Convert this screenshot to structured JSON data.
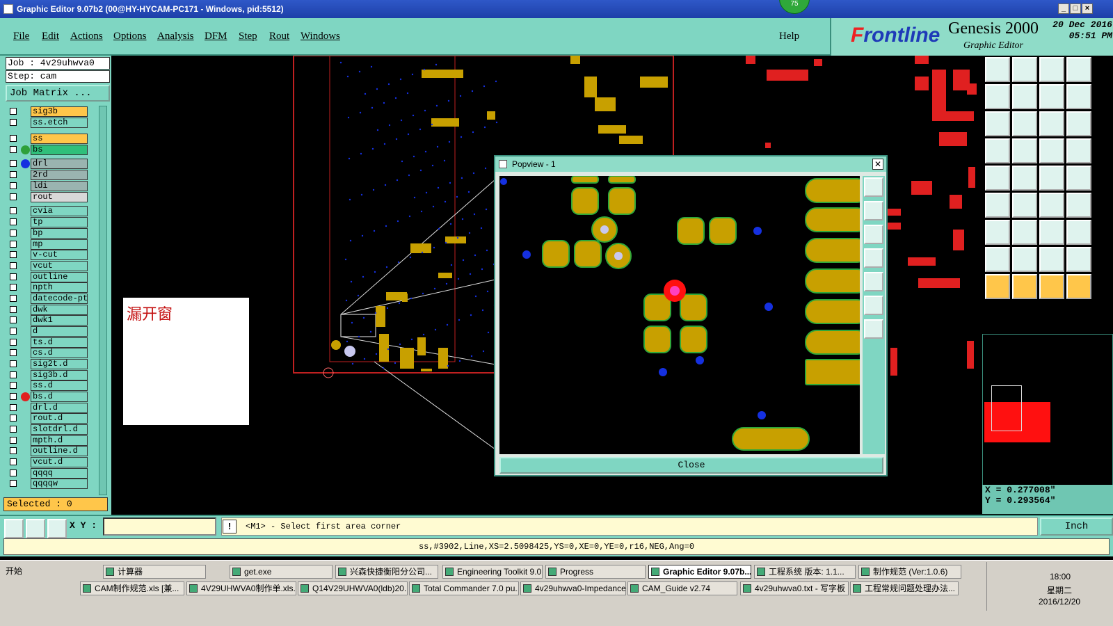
{
  "window": {
    "title": "Graphic Editor 9.07b2 (00@HY-HYCAM-PC171 - Windows, pid:5512)",
    "badge": "75"
  },
  "menu": {
    "items": [
      "File",
      "Edit",
      "Actions",
      "Options",
      "Analysis",
      "DFM",
      "Step",
      "Rout",
      "Windows"
    ],
    "help": "Help"
  },
  "brand": {
    "logo_f": "F",
    "logo_rest": "rontline",
    "product": "Genesis 2000",
    "subtitle": "Graphic Editor",
    "date": "20 Dec 2016",
    "time": "05:51 PM"
  },
  "job": {
    "job_label": "Job  : 4v29uhwva0",
    "step_label": "Step: cam",
    "matrix_button": "Job Matrix ..."
  },
  "layers": [
    {
      "name": "sig3b",
      "color": "#ffc64a",
      "dot": "",
      "mark": "✎"
    },
    {
      "name": "ss.etch",
      "color": "#7fd6c2",
      "dot": "",
      "mark": ""
    },
    {
      "name": "ss",
      "color": "#ffc64a",
      "dot": "",
      "mark": "✎"
    },
    {
      "name": "bs",
      "color": "#2fbf7a",
      "dot": "#2fa03a",
      "mark": ""
    },
    {
      "name": "drl",
      "color": "#9ab4b0",
      "dot": "#1530e0",
      "mark": ""
    },
    {
      "name": "2rd",
      "color": "#9ab4b0",
      "dot": "",
      "mark": ""
    },
    {
      "name": "ldi",
      "color": "#9ab4b0",
      "dot": "",
      "mark": ""
    },
    {
      "name": "rout",
      "color": "#d8d8d8",
      "dot": "",
      "mark": ""
    },
    {
      "name": "cvia",
      "color": "#7fd6c2",
      "dot": "",
      "mark": ""
    },
    {
      "name": "tp",
      "color": "#7fd6c2",
      "dot": "",
      "mark": ""
    },
    {
      "name": "bp",
      "color": "#7fd6c2",
      "dot": "",
      "mark": ""
    },
    {
      "name": "mp",
      "color": "#7fd6c2",
      "dot": "",
      "mark": ""
    },
    {
      "name": "v-cut",
      "color": "#7fd6c2",
      "dot": "",
      "mark": ""
    },
    {
      "name": "vcut",
      "color": "#7fd6c2",
      "dot": "",
      "mark": ""
    },
    {
      "name": "outline",
      "color": "#7fd6c2",
      "dot": "",
      "mark": ""
    },
    {
      "name": "npth",
      "color": "#7fd6c2",
      "dot": "",
      "mark": ""
    },
    {
      "name": "datecode-pt",
      "color": "#7fd6c2",
      "dot": "",
      "mark": ""
    },
    {
      "name": "dwk",
      "color": "#7fd6c2",
      "dot": "",
      "mark": ""
    },
    {
      "name": "dwk1",
      "color": "#7fd6c2",
      "dot": "",
      "mark": ""
    },
    {
      "name": "d",
      "color": "#7fd6c2",
      "dot": "",
      "mark": ""
    },
    {
      "name": "ts.d",
      "color": "#7fd6c2",
      "dot": "",
      "mark": ""
    },
    {
      "name": "cs.d",
      "color": "#7fd6c2",
      "dot": "",
      "mark": "✎"
    },
    {
      "name": "sig2t.d",
      "color": "#7fd6c2",
      "dot": "",
      "mark": "✎"
    },
    {
      "name": "sig3b.d",
      "color": "#7fd6c2",
      "dot": "",
      "mark": "✎"
    },
    {
      "name": "ss.d",
      "color": "#7fd6c2",
      "dot": "",
      "mark": "✎"
    },
    {
      "name": "bs.d",
      "color": "#7fd6c2",
      "dot": "#e02020",
      "mark": "■"
    },
    {
      "name": "drl.d",
      "color": "#7fd6c2",
      "dot": "",
      "mark": ""
    },
    {
      "name": "rout.d",
      "color": "#7fd6c2",
      "dot": "",
      "mark": ""
    },
    {
      "name": "slotdrl.d",
      "color": "#7fd6c2",
      "dot": "",
      "mark": ""
    },
    {
      "name": "mpth.d",
      "color": "#7fd6c2",
      "dot": "",
      "mark": ""
    },
    {
      "name": "outline.d",
      "color": "#7fd6c2",
      "dot": "",
      "mark": ""
    },
    {
      "name": "vcut.d",
      "color": "#7fd6c2",
      "dot": "",
      "mark": ""
    },
    {
      "name": "qqqq",
      "color": "#7fd6c2",
      "dot": "",
      "mark": ""
    },
    {
      "name": "qqqqw",
      "color": "#7fd6c2",
      "dot": "",
      "mark": ""
    }
  ],
  "selected": "Selected : 0",
  "note": "漏开窗",
  "popview": {
    "title": "Popview - 1",
    "close": "Close"
  },
  "toolbar": {
    "xy_label": "X Y :",
    "xy_value": "",
    "prompt": "<M1> - Select first area corner",
    "units": "Inch"
  },
  "status": "ss,#3902,Line,XS=2.5098425,YS=0,XE=0,YE=0,r16,NEG,Ang=0",
  "coords": {
    "x": "X = 0.277008\"",
    "y": "Y = 0.293564\""
  },
  "taskbar": {
    "start": "开始",
    "row1": [
      "计算器",
      "get.exe",
      "兴森快捷衡阳分公司...",
      "Engineering Toolkit 9.0...",
      "Progress",
      "Graphic Editor 9.07b...",
      "工程系统  版本: 1.1...",
      "制作规范 (Ver:1.0.6)"
    ],
    "row2": [
      "CAM制作规范.xls [兼...",
      "4V29UHWVA0制作单.xls...",
      "Q14V29UHWVA0(ldb)20...",
      "Total Commander 7.0 pu...",
      "4v29uhwva0-Impedance...",
      "CAM_Guide v2.74",
      "4v29uhwva0.txt - 写字板",
      "工程常规问题处理办法..."
    ],
    "active": "Graphic Editor 9.07b...",
    "clock_time": "18:00",
    "clock_day": "星期二",
    "clock_date": "2016/12/20"
  },
  "colors": {
    "accent": "#7fd6c2",
    "copper": "#c8a000",
    "solder": "#e02020",
    "drill": "#1530e0"
  }
}
